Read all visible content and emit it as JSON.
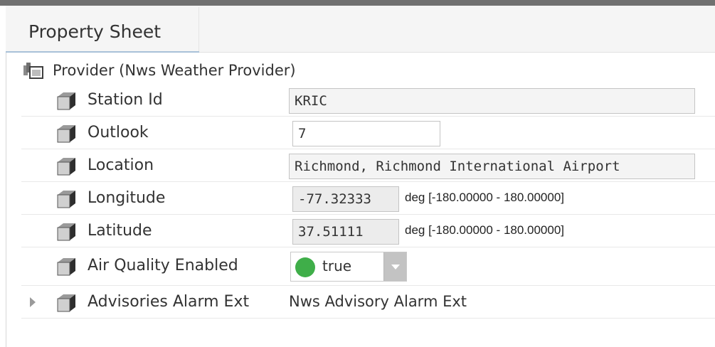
{
  "tab": {
    "label": "Property Sheet"
  },
  "provider": {
    "label": "Provider  (Nws Weather Provider)"
  },
  "properties": [
    {
      "label": "Station Id",
      "value": "KRIC"
    },
    {
      "label": "Outlook",
      "value": "7"
    },
    {
      "label": "Location",
      "value": "Richmond, Richmond International Airport"
    },
    {
      "label": "Longitude",
      "value": "-77.32333",
      "units": "deg [-180.00000 - 180.00000]"
    },
    {
      "label": "Latitude",
      "value": "37.51111",
      "units": "deg [-180.00000 - 180.00000]"
    },
    {
      "label": "Air Quality Enabled",
      "value": "true",
      "status_color": "#3fae49"
    },
    {
      "label": "Advisories Alarm Ext",
      "value": "Nws Advisory Alarm Ext"
    }
  ]
}
